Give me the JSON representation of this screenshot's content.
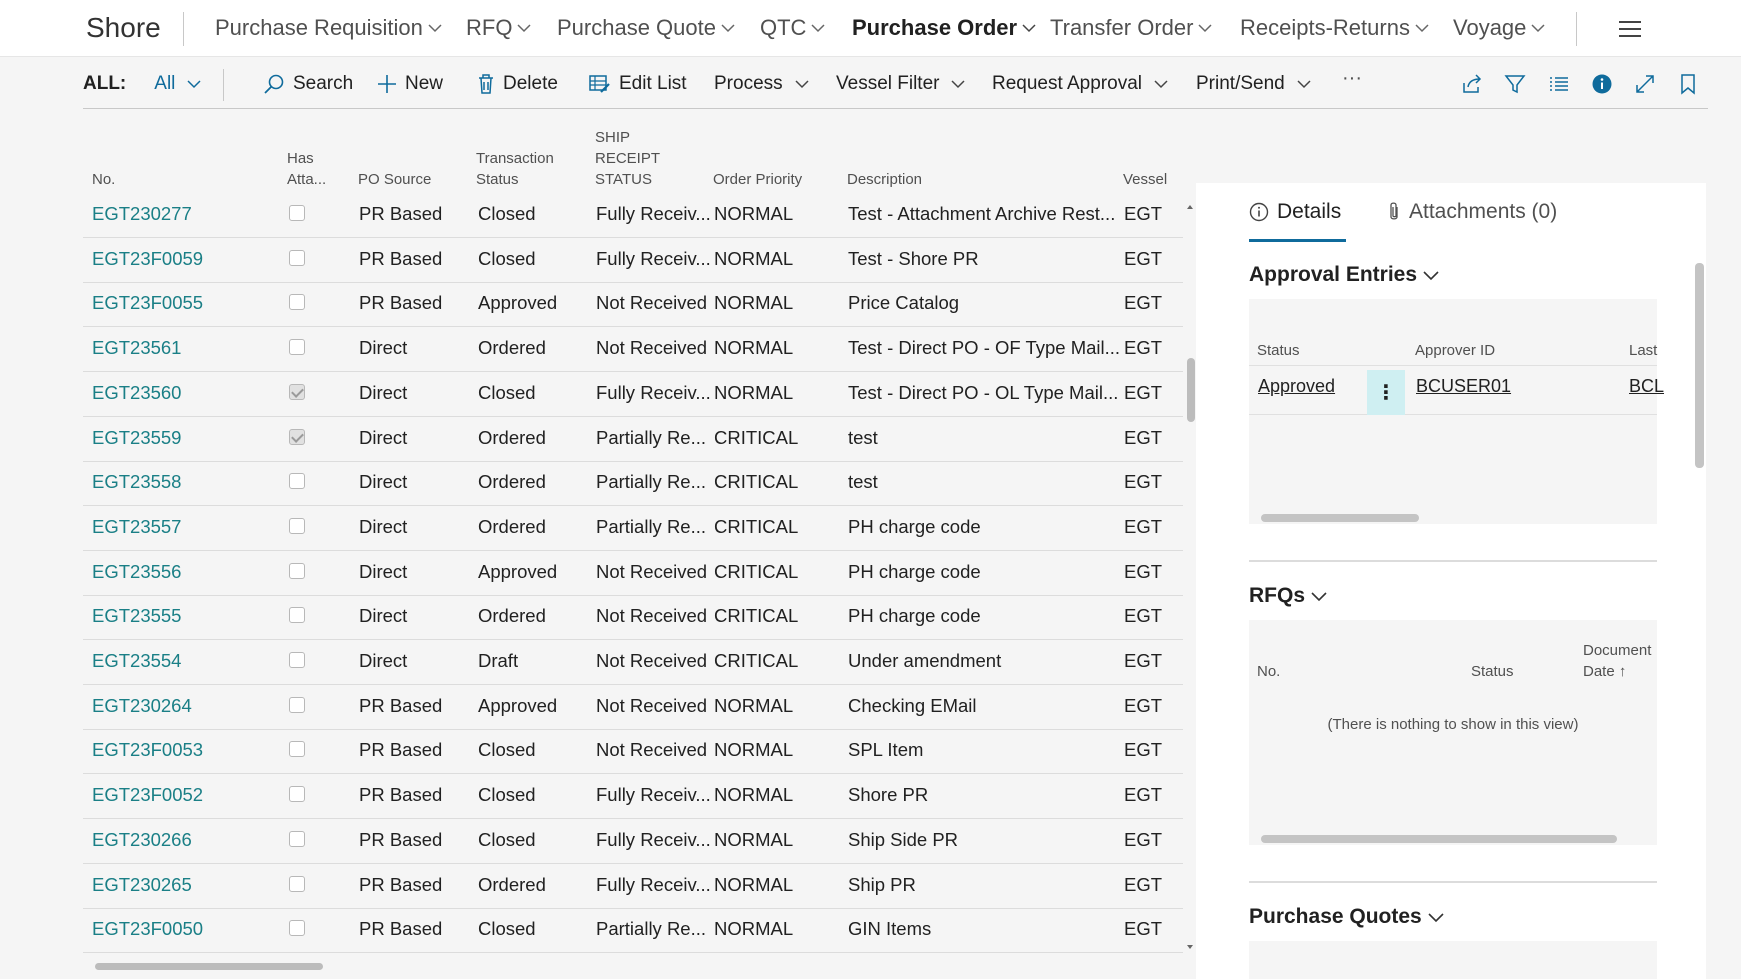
{
  "app": {
    "title": "Shore"
  },
  "nav": {
    "items": [
      {
        "label": "Purchase Requisition",
        "dropdown": true
      },
      {
        "label": "RFQ",
        "dropdown": true
      },
      {
        "label": "Purchase Quote",
        "dropdown": true
      },
      {
        "label": "QTC",
        "dropdown": true
      },
      {
        "label": "Purchase Order",
        "dropdown": true,
        "active": true
      },
      {
        "label": "Transfer Order",
        "dropdown": true
      },
      {
        "label": "Receipts-Returns",
        "dropdown": true
      },
      {
        "label": "Voyage",
        "dropdown": true
      }
    ],
    "menu_icon": "hamburger-icon"
  },
  "actions": {
    "all_label": "ALL:",
    "all_value": "All",
    "search": "Search",
    "new": "New",
    "delete": "Delete",
    "edit_list": "Edit List",
    "process": "Process",
    "vessel_filter": "Vessel Filter",
    "request_approval": "Request Approval",
    "print_send": "Print/Send",
    "more": "···",
    "icons": [
      "share-icon",
      "filter-icon",
      "list-view-icon",
      "info-icon",
      "expand-icon",
      "bookmark-icon"
    ]
  },
  "table": {
    "headers": {
      "no": "No.",
      "has_attachments_line1": "Has",
      "has_attachments_line2": "Atta...",
      "po_source": "PO Source",
      "transaction_status_line1": "Transaction",
      "transaction_status_line2": "Status",
      "ship_receipt_line1": "SHIP",
      "ship_receipt_line2": "RECEIPT",
      "ship_receipt_line3": "STATUS",
      "order_priority": "Order Priority",
      "description": "Description",
      "vessel": "Vessel"
    },
    "rows": [
      {
        "no": "EGT230277",
        "attached": false,
        "source": "PR Based",
        "status": "Closed",
        "receipt": "Fully Receiv...",
        "priority": "NORMAL",
        "description": "Test - Attachment Archive Rest...",
        "vessel": "EGT"
      },
      {
        "no": "EGT23F0059",
        "attached": false,
        "source": "PR Based",
        "status": "Closed",
        "receipt": "Fully Receiv...",
        "priority": "NORMAL",
        "description": "Test - Shore PR",
        "vessel": "EGT"
      },
      {
        "no": "EGT23F0055",
        "attached": false,
        "source": "PR Based",
        "status": "Approved",
        "receipt": "Not Received",
        "priority": "NORMAL",
        "description": "Price Catalog",
        "vessel": "EGT"
      },
      {
        "no": "EGT23561",
        "attached": false,
        "source": "Direct",
        "status": "Ordered",
        "receipt": "Not Received",
        "priority": "NORMAL",
        "description": "Test - Direct PO - OF Type Mail...",
        "vessel": "EGT"
      },
      {
        "no": "EGT23560",
        "attached": true,
        "source": "Direct",
        "status": "Closed",
        "receipt": "Fully Receiv...",
        "priority": "NORMAL",
        "description": "Test - Direct PO - OL Type Mail...",
        "vessel": "EGT"
      },
      {
        "no": "EGT23559",
        "attached": true,
        "source": "Direct",
        "status": "Ordered",
        "receipt": "Partially Re...",
        "priority": "CRITICAL",
        "description": "test",
        "vessel": "EGT"
      },
      {
        "no": "EGT23558",
        "attached": false,
        "source": "Direct",
        "status": "Ordered",
        "receipt": "Partially Re...",
        "priority": "CRITICAL",
        "description": "test",
        "vessel": "EGT"
      },
      {
        "no": "EGT23557",
        "attached": false,
        "source": "Direct",
        "status": "Ordered",
        "receipt": "Partially Re...",
        "priority": "CRITICAL",
        "description": "PH charge code",
        "vessel": "EGT"
      },
      {
        "no": "EGT23556",
        "attached": false,
        "source": "Direct",
        "status": "Approved",
        "receipt": "Not Received",
        "priority": "CRITICAL",
        "description": "PH charge code",
        "vessel": "EGT"
      },
      {
        "no": "EGT23555",
        "attached": false,
        "source": "Direct",
        "status": "Ordered",
        "receipt": "Not Received",
        "priority": "CRITICAL",
        "description": "PH charge code",
        "vessel": "EGT"
      },
      {
        "no": "EGT23554",
        "attached": false,
        "source": "Direct",
        "status": "Draft",
        "receipt": "Not Received",
        "priority": "CRITICAL",
        "description": "Under amendment",
        "vessel": "EGT"
      },
      {
        "no": "EGT230264",
        "attached": false,
        "source": "PR Based",
        "status": "Approved",
        "receipt": "Not Received",
        "priority": "NORMAL",
        "description": "Checking EMail",
        "vessel": "EGT"
      },
      {
        "no": "EGT23F0053",
        "attached": false,
        "source": "PR Based",
        "status": "Closed",
        "receipt": "Not Received",
        "priority": "NORMAL",
        "description": "SPL Item",
        "vessel": "EGT"
      },
      {
        "no": "EGT23F0052",
        "attached": false,
        "source": "PR Based",
        "status": "Closed",
        "receipt": "Fully Receiv...",
        "priority": "NORMAL",
        "description": "Shore PR",
        "vessel": "EGT"
      },
      {
        "no": "EGT230266",
        "attached": false,
        "source": "PR Based",
        "status": "Closed",
        "receipt": "Fully Receiv...",
        "priority": "NORMAL",
        "description": "Ship Side PR",
        "vessel": "EGT"
      },
      {
        "no": "EGT230265",
        "attached": false,
        "source": "PR Based",
        "status": "Ordered",
        "receipt": "Fully Receiv...",
        "priority": "NORMAL",
        "description": "Ship PR",
        "vessel": "EGT"
      },
      {
        "no": "EGT23F0050",
        "attached": false,
        "source": "PR Based",
        "status": "Closed",
        "receipt": "Partially Re...",
        "priority": "NORMAL",
        "description": "GIN Items",
        "vessel": "EGT"
      }
    ]
  },
  "factbox": {
    "tab_details": "Details",
    "tab_attachments": "Attachments (0)",
    "approval": {
      "title": "Approval Entries",
      "col_status": "Status",
      "col_approver": "Approver ID",
      "col_last": "Last",
      "row_status": "Approved",
      "row_approver": "BCUSER01",
      "row_last": "BCL"
    },
    "rfqs": {
      "title": "RFQs",
      "col_no": "No.",
      "col_status": "Status",
      "col_doc_line1": "Document",
      "col_doc_line2": "Date ↑",
      "empty": "(There is nothing to show in this view)"
    },
    "purchase_quotes": {
      "title": "Purchase Quotes"
    }
  },
  "colors": {
    "accent": "#0f6b9c",
    "link": "#1a7f86",
    "selected_action": "#cfeff2"
  }
}
